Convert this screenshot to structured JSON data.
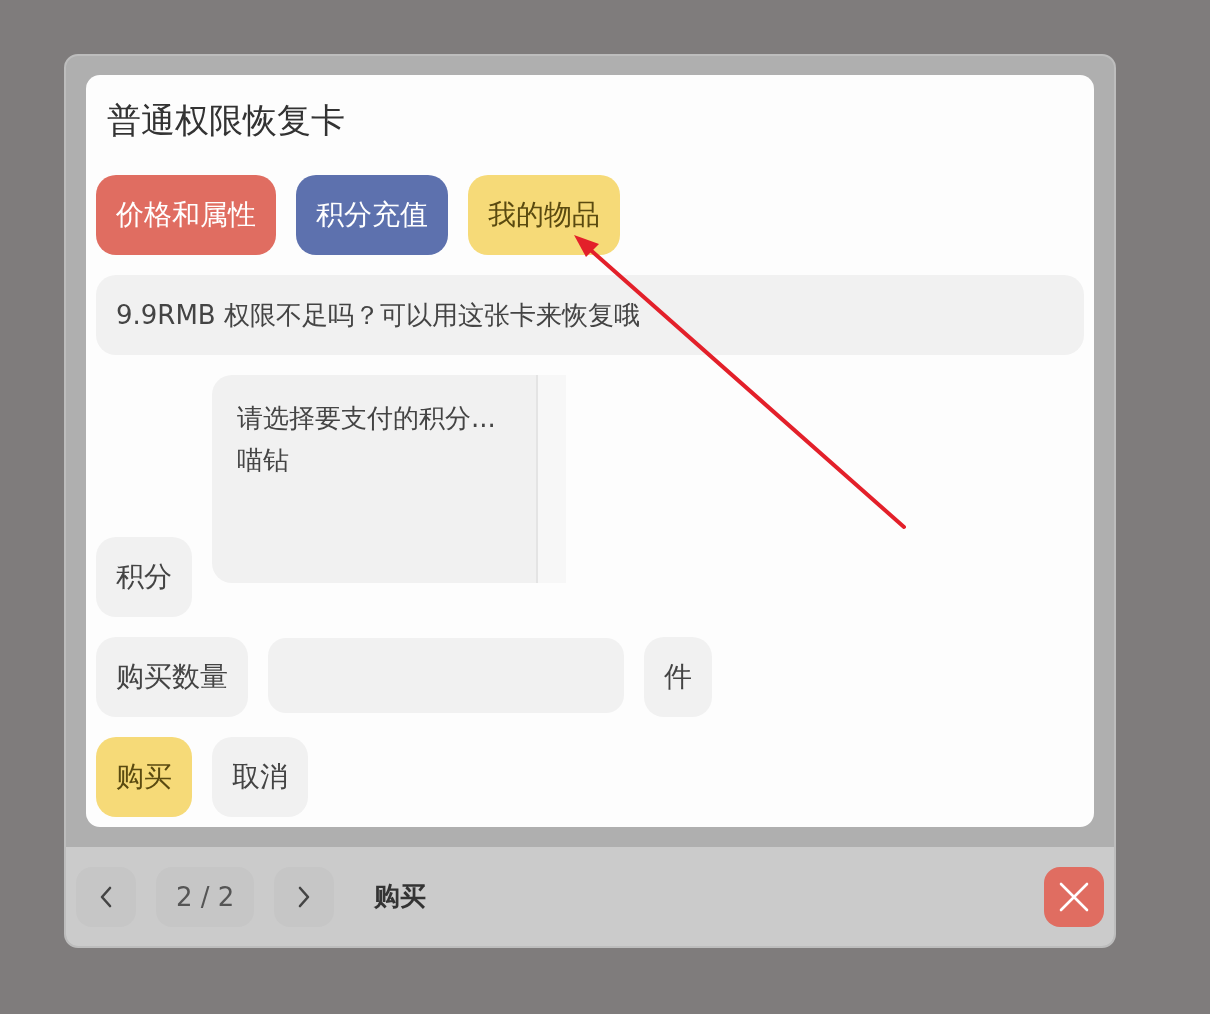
{
  "dialog": {
    "title": "普通权限恢复卡",
    "tabs": [
      {
        "label": "价格和属性",
        "color": "#e06d61"
      },
      {
        "label": "积分充值",
        "color": "#5d71ae"
      },
      {
        "label": "我的物品",
        "color": "#f6da78"
      }
    ],
    "notice": "9.9RMB 权限不足吗？可以用这张卡来恢复哦",
    "points": {
      "label": "积分",
      "placeholder": "请选择要支付的积分...",
      "options": [
        "喵钻"
      ]
    },
    "quantity": {
      "label": "购买数量",
      "unit": "件"
    },
    "actions": [
      {
        "label": "购买",
        "kind": "primary"
      },
      {
        "label": "取消",
        "kind": "secondary"
      }
    ],
    "footer": {
      "page": "2 / 2",
      "title": "购买"
    }
  }
}
